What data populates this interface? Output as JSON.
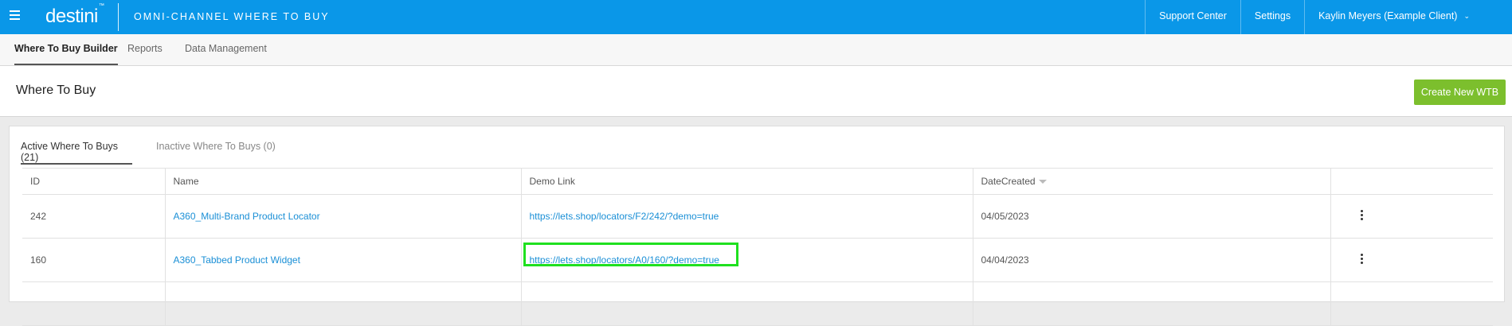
{
  "topbar": {
    "logo": "destini",
    "logo_tm": "™",
    "app_title": "Omni-Channel Where To Buy",
    "nav": [
      {
        "label": "Support Center"
      },
      {
        "label": "Settings"
      },
      {
        "label": "Kaylin Meyers (Example Client)"
      }
    ],
    "icons": {
      "menu": "hamburger-icon",
      "user_dropdown": "chevron-down-icon"
    },
    "background_color": "#0a97e8"
  },
  "subnav": {
    "tabs": [
      {
        "label": "Where To Buy Builder",
        "active": true
      },
      {
        "label": "Reports",
        "active": false
      },
      {
        "label": "Data Management",
        "active": false
      }
    ]
  },
  "page": {
    "title": "Where To Buy",
    "create_button": "Create New WTB",
    "create_button_color": "#7cbf2d"
  },
  "card": {
    "tabs": [
      {
        "label": "Active Where To Buys (21)",
        "active": true
      },
      {
        "label": "Inactive Where To Buys (0)",
        "active": false
      }
    ],
    "table": {
      "columns": [
        "ID",
        "Name",
        "Demo Link",
        "DateCreated",
        ""
      ],
      "sort_column": "DateCreated",
      "rows": [
        {
          "id": "242",
          "name": "A360_Multi-Brand Product Locator",
          "demo_link": "https://lets.shop/locators/F2/242/?demo=true",
          "date": "04/05/2023"
        },
        {
          "id": "160",
          "name": "A360_Tabbed Product Widget",
          "demo_link": "https://lets.shop/locators/A0/160/?demo=true",
          "date": "04/04/2023"
        }
      ]
    }
  },
  "highlight": {
    "target": "https://lets.shop/locators/A0/160/?demo=true",
    "color": "#1fe01f"
  }
}
